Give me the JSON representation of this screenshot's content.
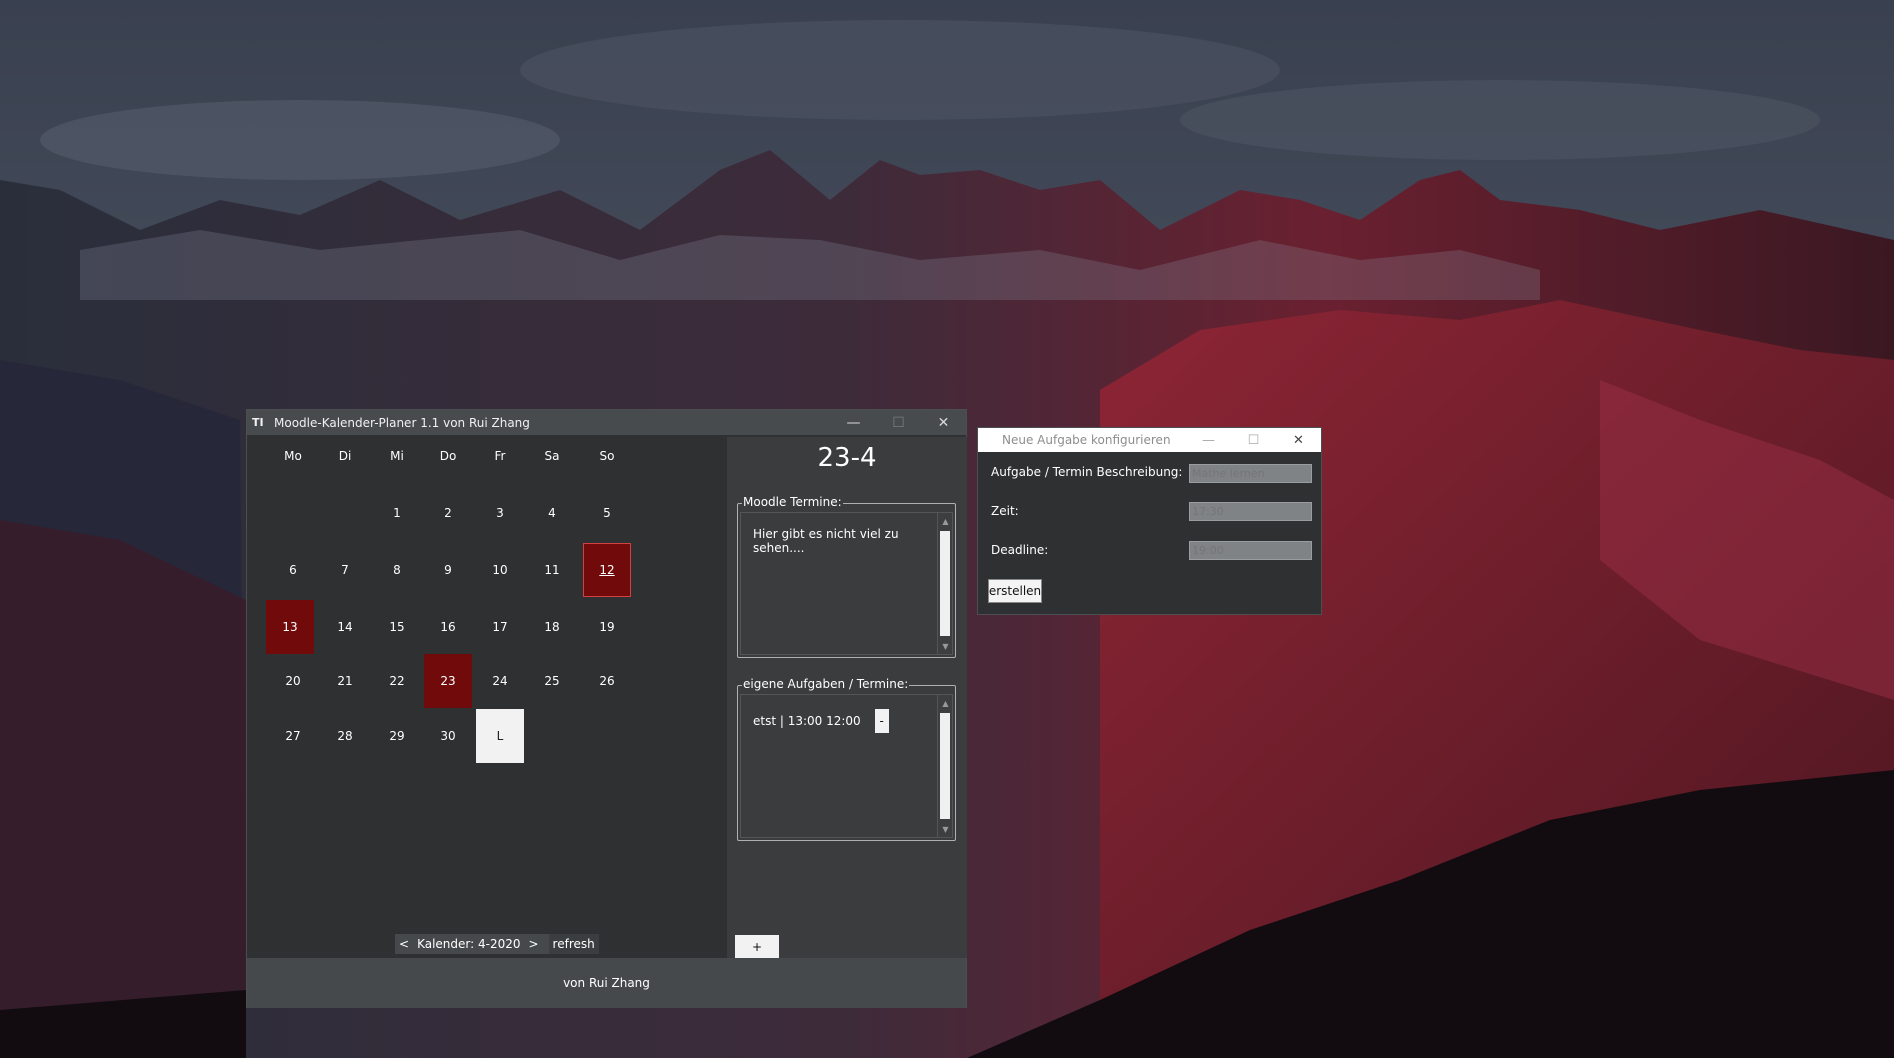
{
  "main_window": {
    "title": "Moodle-Kalender-Planer 1.1 von Rui Zhang",
    "app_icon": "TI",
    "weekdays": [
      "Mo",
      "Di",
      "Mi",
      "Do",
      "Fr",
      "Sa",
      "So"
    ],
    "calendar_rows": [
      [
        "",
        "",
        "1",
        "2",
        "3",
        "4",
        "5"
      ],
      [
        "6",
        "7",
        "8",
        "9",
        "10",
        "11",
        "12"
      ],
      [
        "13",
        "14",
        "15",
        "16",
        "17",
        "18",
        "19"
      ],
      [
        "20",
        "21",
        "22",
        "23",
        "24",
        "25",
        "26"
      ],
      [
        "27",
        "28",
        "29",
        "30",
        "L",
        "",
        ""
      ]
    ],
    "marked_days": [
      "12",
      "13",
      "23"
    ],
    "focused_day": "12",
    "today_cell": "L",
    "nav": {
      "prev": "<",
      "label": "Kalender: 4-2020",
      "next": ">",
      "refresh": "refresh"
    },
    "selected_day_label": "23-4",
    "moodle_group": {
      "title": "Moodle Termine:",
      "text": "Hier gibt es nicht viel zu sehen...."
    },
    "tasks_group": {
      "title": "eigene Aufgaben / Termine:",
      "tasks": [
        {
          "text": "etst | 13:00 12:00",
          "delete_label": "-"
        }
      ]
    },
    "add_label": "+",
    "footer": "von Rui Zhang",
    "colors": {
      "window_bg": "#2e3031",
      "side_bg": "#3a3c3e",
      "marked": "#710a0a",
      "titlebar": "#474b4e"
    }
  },
  "dialog": {
    "title": "Neue Aufgabe konfigurieren",
    "fields": [
      {
        "label": "Aufgabe / Termin Beschreibung:",
        "placeholder": "Mathe lernen"
      },
      {
        "label": "Zeit:",
        "placeholder": "17:30"
      },
      {
        "label": "Deadline:",
        "placeholder": "19:00"
      }
    ],
    "create_label": "erstellen"
  },
  "icons": [
    "minimize-icon",
    "maximize-icon",
    "close-icon",
    "scroll-up-icon",
    "scroll-down-icon"
  ]
}
